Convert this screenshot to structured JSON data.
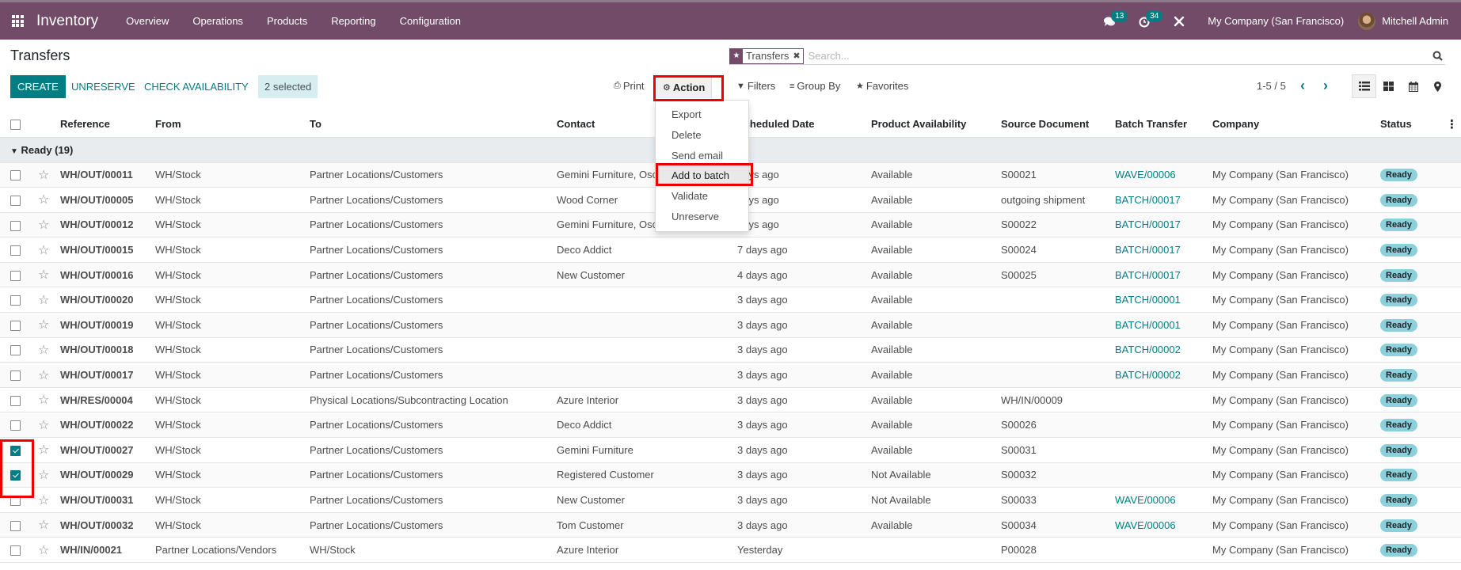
{
  "navbar": {
    "app_name": "Inventory",
    "menu": [
      "Overview",
      "Operations",
      "Products",
      "Reporting",
      "Configuration"
    ],
    "messages_count": "13",
    "activities_count": "34",
    "company": "My Company (San Francisco)",
    "user": "Mitchell Admin",
    "icons": [
      "apps-grid-icon",
      "chat-icon",
      "clock-icon",
      "tools-icon"
    ]
  },
  "control_panel": {
    "title": "Transfers",
    "search": {
      "facet_label": "Transfers",
      "placeholder": "Search..."
    },
    "buttons": {
      "create": "CREATE",
      "unreserve": "UNRESERVE",
      "check_availability": "CHECK AVAILABILITY"
    },
    "selected_label": "2 selected",
    "print": "Print",
    "action": "Action",
    "filters": "Filters",
    "group_by": "Group By",
    "favorites": "Favorites",
    "pager": "1-5 / 5",
    "views": [
      "list",
      "kanban",
      "calendar",
      "map"
    ],
    "active_view": "list"
  },
  "action_menu": {
    "items": [
      "Export",
      "Delete",
      "Send email",
      "Add to batch",
      "Validate",
      "Unreserve"
    ],
    "highlighted": "Add to batch"
  },
  "table": {
    "columns": [
      "Reference",
      "From",
      "To",
      "Contact",
      "Scheduled Date",
      "Product Availability",
      "Source Document",
      "Batch Transfer",
      "Company",
      "Status"
    ],
    "group": {
      "label": "Ready (19)",
      "expanded": true
    },
    "rows": [
      {
        "selected": false,
        "reference": "WH/OUT/00011",
        "from": "WH/Stock",
        "to": "Partner Locations/Customers",
        "contact": "Gemini Furniture, Oscar Morgan",
        "scheduled_date": "days ago",
        "availability": "Available",
        "source": "S00021",
        "batch": "WAVE/00006",
        "company": "My Company (San Francisco)",
        "status": "Ready"
      },
      {
        "selected": false,
        "reference": "WH/OUT/00005",
        "from": "WH/Stock",
        "to": "Partner Locations/Customers",
        "contact": "Wood Corner",
        "scheduled_date": "days ago",
        "availability": "Available",
        "source": "outgoing shipment",
        "batch": "BATCH/00017",
        "company": "My Company (San Francisco)",
        "status": "Ready"
      },
      {
        "selected": false,
        "reference": "WH/OUT/00012",
        "from": "WH/Stock",
        "to": "Partner Locations/Customers",
        "contact": "Gemini Furniture, Oscar Morgan",
        "scheduled_date": "days ago",
        "availability": "Available",
        "source": "S00022",
        "batch": "BATCH/00017",
        "company": "My Company (San Francisco)",
        "status": "Ready"
      },
      {
        "selected": false,
        "reference": "WH/OUT/00015",
        "from": "WH/Stock",
        "to": "Partner Locations/Customers",
        "contact": "Deco Addict",
        "scheduled_date": "7 days ago",
        "availability": "Available",
        "source": "S00024",
        "batch": "BATCH/00017",
        "company": "My Company (San Francisco)",
        "status": "Ready"
      },
      {
        "selected": false,
        "reference": "WH/OUT/00016",
        "from": "WH/Stock",
        "to": "Partner Locations/Customers",
        "contact": "New Customer",
        "scheduled_date": "4 days ago",
        "availability": "Available",
        "source": "S00025",
        "batch": "BATCH/00017",
        "company": "My Company (San Francisco)",
        "status": "Ready"
      },
      {
        "selected": false,
        "reference": "WH/OUT/00020",
        "from": "WH/Stock",
        "to": "Partner Locations/Customers",
        "contact": "",
        "scheduled_date": "3 days ago",
        "availability": "Available",
        "source": "",
        "batch": "BATCH/00001",
        "company": "My Company (San Francisco)",
        "status": "Ready"
      },
      {
        "selected": false,
        "reference": "WH/OUT/00019",
        "from": "WH/Stock",
        "to": "Partner Locations/Customers",
        "contact": "",
        "scheduled_date": "3 days ago",
        "availability": "Available",
        "source": "",
        "batch": "BATCH/00001",
        "company": "My Company (San Francisco)",
        "status": "Ready"
      },
      {
        "selected": false,
        "reference": "WH/OUT/00018",
        "from": "WH/Stock",
        "to": "Partner Locations/Customers",
        "contact": "",
        "scheduled_date": "3 days ago",
        "availability": "Available",
        "source": "",
        "batch": "BATCH/00002",
        "company": "My Company (San Francisco)",
        "status": "Ready"
      },
      {
        "selected": false,
        "reference": "WH/OUT/00017",
        "from": "WH/Stock",
        "to": "Partner Locations/Customers",
        "contact": "",
        "scheduled_date": "3 days ago",
        "availability": "Available",
        "source": "",
        "batch": "BATCH/00002",
        "company": "My Company (San Francisco)",
        "status": "Ready"
      },
      {
        "selected": false,
        "reference": "WH/RES/00004",
        "from": "WH/Stock",
        "to": "Physical Locations/Subcontracting Location",
        "contact": "Azure Interior",
        "scheduled_date": "3 days ago",
        "availability": "Available",
        "source": "WH/IN/00009",
        "batch": "",
        "company": "My Company (San Francisco)",
        "status": "Ready"
      },
      {
        "selected": false,
        "reference": "WH/OUT/00022",
        "from": "WH/Stock",
        "to": "Partner Locations/Customers",
        "contact": "Deco Addict",
        "scheduled_date": "3 days ago",
        "availability": "Available",
        "source": "S00026",
        "batch": "",
        "company": "My Company (San Francisco)",
        "status": "Ready"
      },
      {
        "selected": true,
        "reference": "WH/OUT/00027",
        "from": "WH/Stock",
        "to": "Partner Locations/Customers",
        "contact": "Gemini Furniture",
        "scheduled_date": "3 days ago",
        "availability": "Available",
        "source": "S00031",
        "batch": "",
        "company": "My Company (San Francisco)",
        "status": "Ready"
      },
      {
        "selected": true,
        "reference": "WH/OUT/00029",
        "from": "WH/Stock",
        "to": "Partner Locations/Customers",
        "contact": "Registered Customer",
        "scheduled_date": "3 days ago",
        "availability": "Not Available",
        "source": "S00032",
        "batch": "",
        "company": "My Company (San Francisco)",
        "status": "Ready"
      },
      {
        "selected": false,
        "reference": "WH/OUT/00031",
        "from": "WH/Stock",
        "to": "Partner Locations/Customers",
        "contact": "New Customer",
        "scheduled_date": "3 days ago",
        "availability": "Not Available",
        "source": "S00033",
        "batch": "WAVE/00006",
        "company": "My Company (San Francisco)",
        "status": "Ready"
      },
      {
        "selected": false,
        "reference": "WH/OUT/00032",
        "from": "WH/Stock",
        "to": "Partner Locations/Customers",
        "contact": "Tom Customer",
        "scheduled_date": "3 days ago",
        "availability": "Available",
        "source": "S00034",
        "batch": "WAVE/00006",
        "company": "My Company (San Francisco)",
        "status": "Ready"
      },
      {
        "selected": false,
        "reference": "WH/IN/00021",
        "from": "Partner Locations/Vendors",
        "to": "WH/Stock",
        "contact": "Azure Interior",
        "scheduled_date": "Yesterday",
        "availability": "",
        "source": "P00028",
        "batch": "",
        "company": "My Company (San Francisco)",
        "status": "Ready"
      }
    ]
  },
  "colors": {
    "brand": "#714b67",
    "primary": "#017e84",
    "late_date": "#d44c59",
    "available": "#23962e",
    "status_badge": "#8bd0da",
    "highlight": "#ef0000"
  }
}
